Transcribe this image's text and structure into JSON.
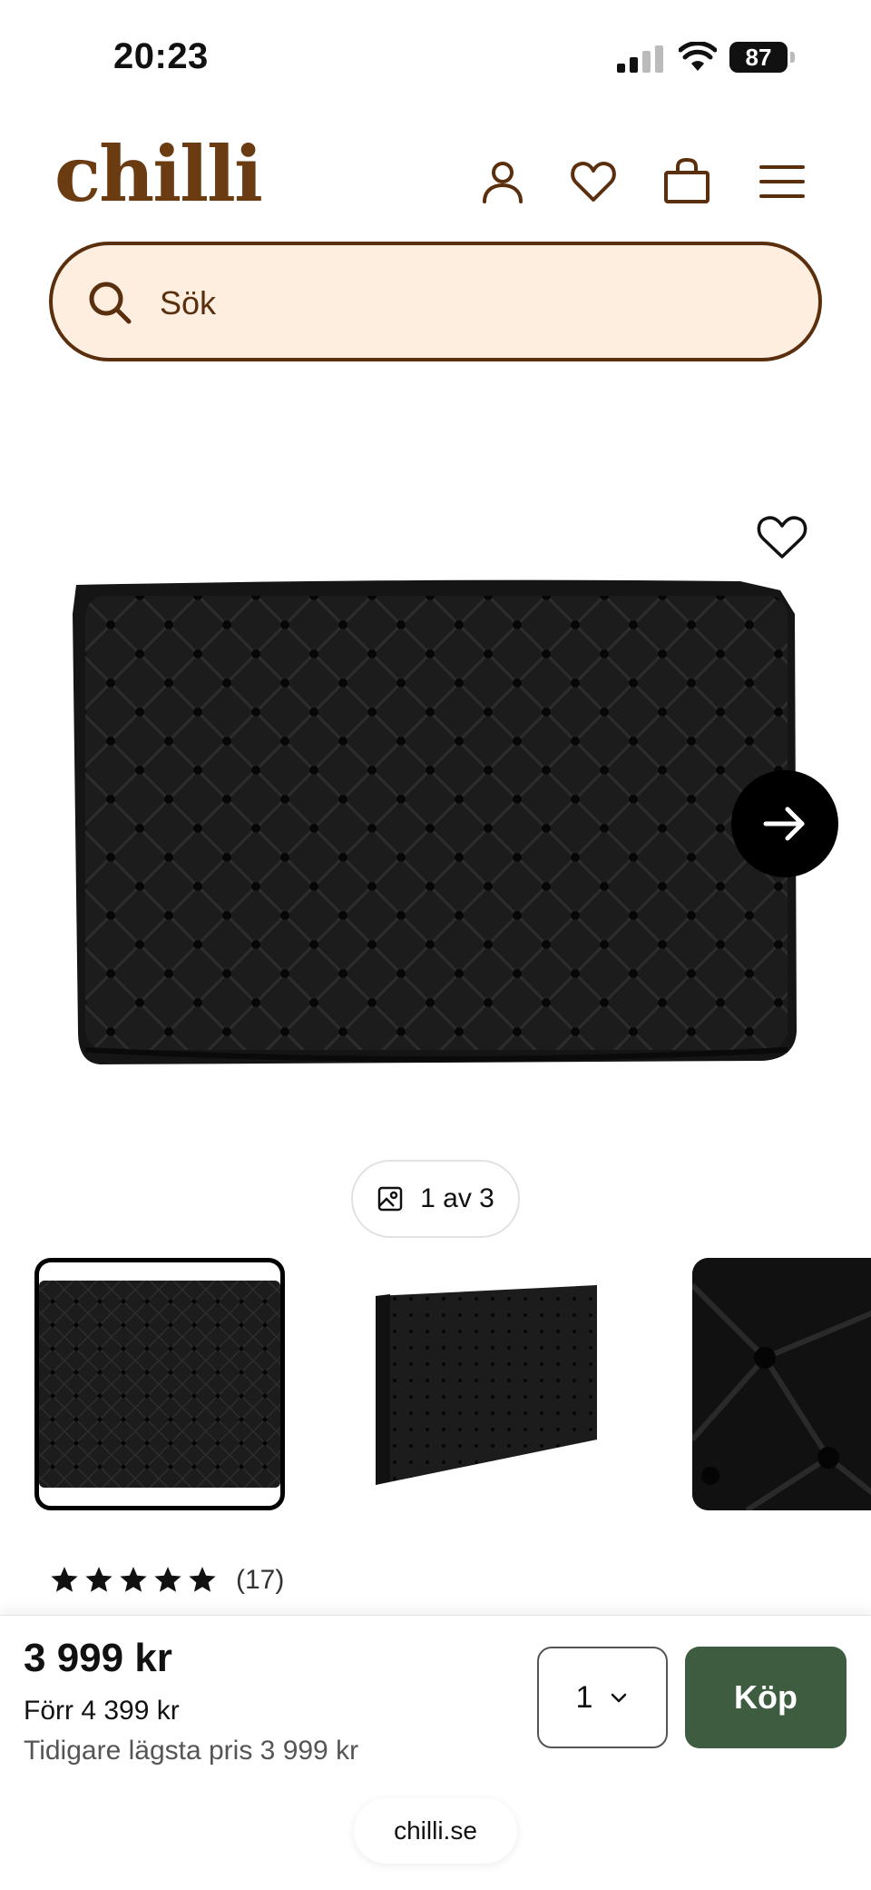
{
  "status_bar": {
    "time": "20:23",
    "battery": "87"
  },
  "header": {
    "logo": "chilli",
    "icons": [
      "account-icon",
      "heart-icon",
      "cart-icon",
      "menu-icon"
    ]
  },
  "search": {
    "placeholder": "Sök"
  },
  "gallery": {
    "counter": "1 av 3",
    "image_count": 3,
    "thumbnails": [
      "headboard-front",
      "headboard-angle",
      "headboard-closeup"
    ]
  },
  "rating": {
    "stars": 5,
    "count": "(17)"
  },
  "buy_bar": {
    "price": "3 999 kr",
    "was_price": "Förr 4 399 kr",
    "lowest_price": "Tidigare lägsta pris 3 999 kr",
    "quantity": "1",
    "buy_label": "Köp"
  },
  "browser": {
    "url": "chilli.se"
  },
  "colors": {
    "brand_brown": "#6b3b12",
    "search_bg": "#fdeee0",
    "buy_green": "#3d5c40"
  }
}
